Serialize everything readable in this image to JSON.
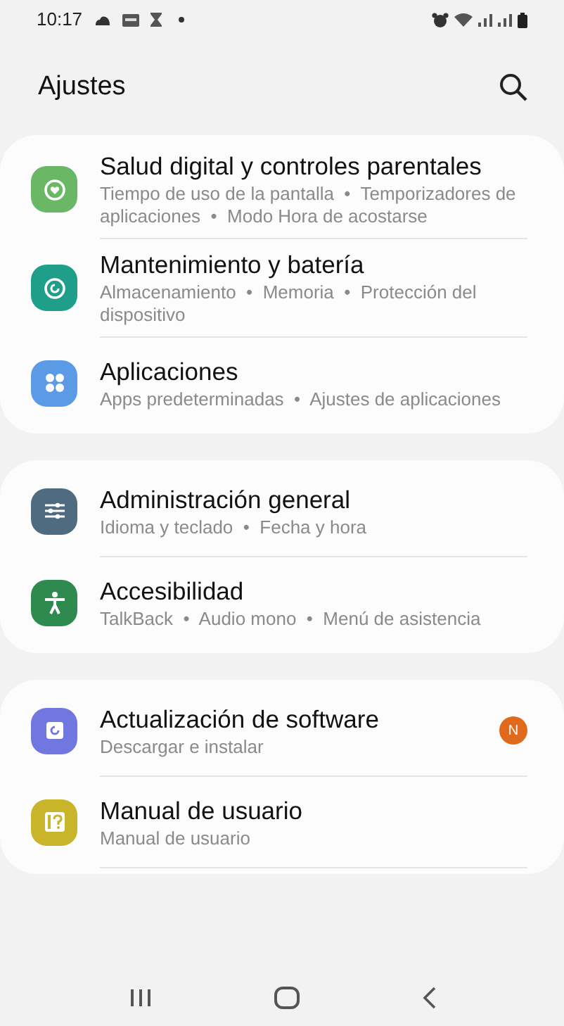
{
  "status_bar": {
    "time": "10:17"
  },
  "header": {
    "title": "Ajustes"
  },
  "groups": [
    {
      "items": [
        {
          "kind": "wellbeing",
          "color": "#6ab866",
          "title": "Salud digital y controles parentales",
          "subtitle": "Tiempo de uso de la pantalla  •  Temporizadores de aplicaciones  •  Modo Hora de acostarse"
        },
        {
          "kind": "care",
          "color": "#1f9e8a",
          "title": "Mantenimiento y batería",
          "subtitle": "Almacenamiento  •  Memoria  •  Protección del dispositivo"
        },
        {
          "kind": "apps",
          "color": "#5b9be6",
          "title": "Aplicaciones",
          "subtitle": "Apps predeterminadas  •  Ajustes de aplicaciones"
        }
      ]
    },
    {
      "items": [
        {
          "kind": "sliders",
          "color": "#4f6b80",
          "title": "Administración general",
          "subtitle": "Idioma y teclado  •  Fecha y hora"
        },
        {
          "kind": "person",
          "color": "#2e8a4e",
          "title": "Accesibilidad",
          "subtitle": "TalkBack  •  Audio mono  •  Menú de asistencia"
        }
      ]
    },
    {
      "items": [
        {
          "kind": "update",
          "color": "#7078e0",
          "title": "Actualización de software",
          "subtitle": "Descargar e instalar",
          "badge": "N"
        },
        {
          "kind": "manual",
          "color": "#c9b52a",
          "title": "Manual de usuario",
          "subtitle": "Manual de usuario"
        }
      ]
    }
  ]
}
